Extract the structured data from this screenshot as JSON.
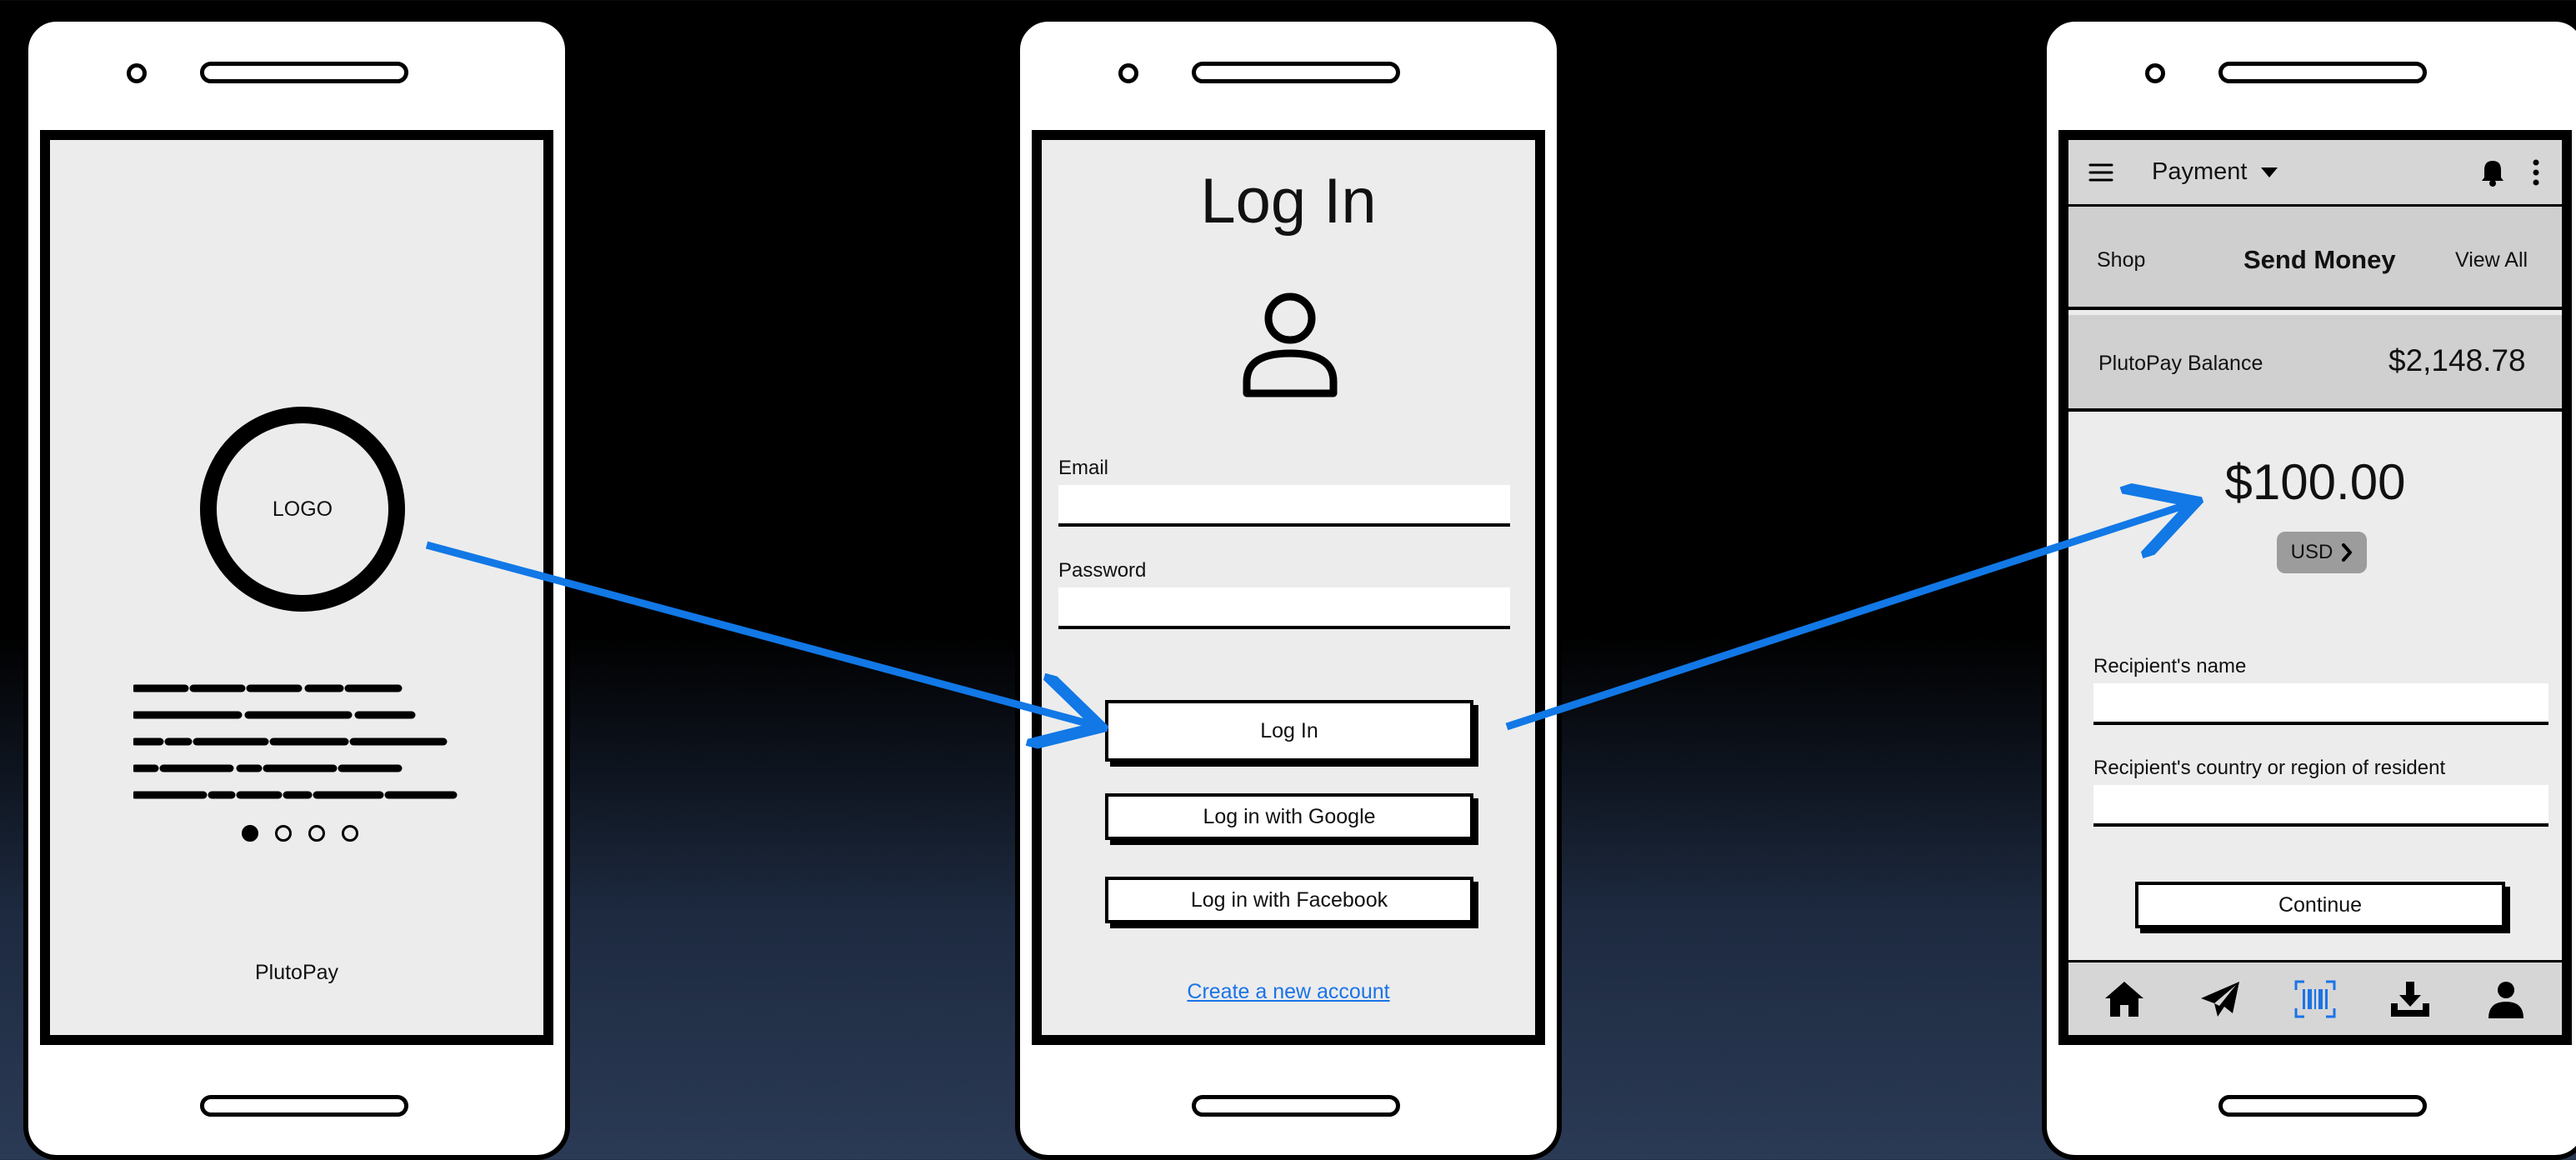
{
  "colors": {
    "accent": "#1a73e8",
    "arrow": "#1178e6"
  },
  "onboarding": {
    "logo_text": "LOGO",
    "carousel_pages": 4,
    "carousel_active": 1,
    "brand_name": "PlutoPay"
  },
  "login": {
    "title": "Log In",
    "email_label": "Email",
    "email_value": "",
    "password_label": "Password",
    "password_value": "",
    "login_button": "Log In",
    "google_button": "Log in with Google",
    "facebook_button": "Log in with Facebook",
    "create_account_link": "Create a new account"
  },
  "payment": {
    "header_title": "Payment",
    "tabs": {
      "left": "Shop",
      "center": "Send Money",
      "right": "View All"
    },
    "balance_label": "PlutoPay Balance",
    "balance_value": "$2,148.78",
    "amount": "$100.00",
    "currency": "USD",
    "recipient_name_label": "Recipient's name",
    "recipient_name_value": "",
    "recipient_country_label": "Recipient's country or region of resident",
    "recipient_country_value": "",
    "continue_button": "Continue",
    "bottom_tabs": [
      "home-icon",
      "send-icon",
      "barcode-icon",
      "download-icon",
      "profile-icon"
    ],
    "active_bottom_tab": "barcode-icon"
  }
}
